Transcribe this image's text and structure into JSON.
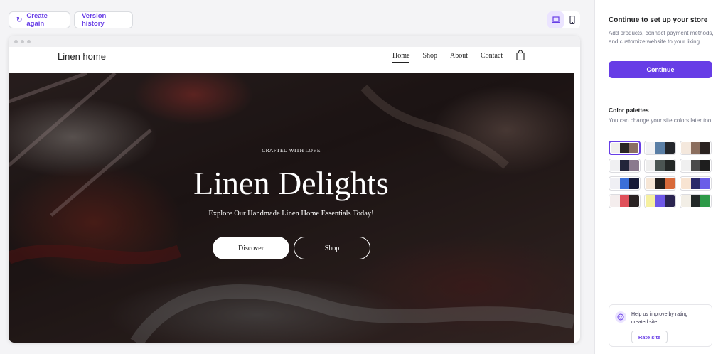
{
  "toolbar": {
    "create_again_label": "Create again",
    "version_history_label": "Version history"
  },
  "device_toggle": {
    "active": "desktop"
  },
  "site": {
    "logo": "Linen home",
    "nav": [
      "Home",
      "Shop",
      "About",
      "Contact"
    ],
    "hero": {
      "eyebrow": "CRAFTED WITH LOVE",
      "title": "Linen Delights",
      "subtitle": "Explore Our Handmade Linen Home Essentials Today!",
      "primary_button": "Discover",
      "secondary_button": "Shop"
    }
  },
  "panel": {
    "title": "Continue to set up your store",
    "description": "Add products, connect payment methods, and customize website to your liking.",
    "continue_label": "Continue",
    "palettes_title": "Color palettes",
    "palettes_description": "You can change your site colors later too.",
    "palettes": [
      [
        "#f0eeec",
        "#2b2624",
        "#8a6e63"
      ],
      [
        "#f2f2f4",
        "#5a7fa6",
        "#23262b"
      ],
      [
        "#f4e8dd",
        "#8b6e5e",
        "#2a2220"
      ],
      [
        "#f0f0f2",
        "#22243a",
        "#8a7a8e"
      ],
      [
        "#eeeeee",
        "#4b5552",
        "#242826"
      ],
      [
        "#f0f0f0",
        "#4a4a4a",
        "#1e1e1e"
      ],
      [
        "#efeff4",
        "#3b6fd8",
        "#161a38"
      ],
      [
        "#f6e6d6",
        "#24201e",
        "#d86a3a"
      ],
      [
        "#f8e4d2",
        "#2a2868",
        "#6a5de8"
      ],
      [
        "#f4eded",
        "#e0505a",
        "#2a2222"
      ],
      [
        "#f6f0a0",
        "#6e58e8",
        "#2a2450"
      ],
      [
        "#f2eee6",
        "#222826",
        "#2e9a48"
      ]
    ],
    "selected_palette": 0,
    "rate": {
      "text": "Help us improve by rating created site",
      "button": "Rate site"
    }
  },
  "colors": {
    "accent": "#673de6"
  }
}
